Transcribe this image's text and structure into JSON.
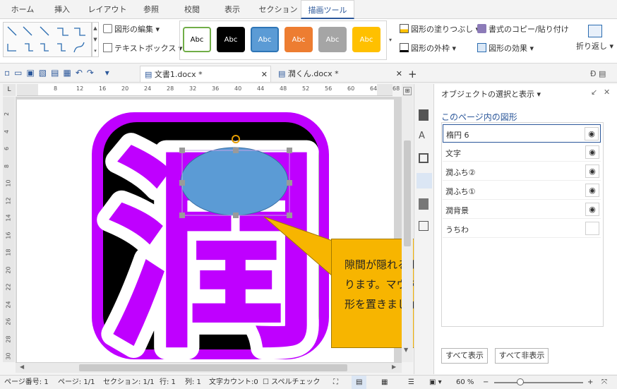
{
  "tabs": [
    "ホーム",
    "挿入",
    "レイアウト",
    "参照",
    "校閲",
    "表示",
    "セクション",
    "描画ツール"
  ],
  "ribbon": {
    "edit_shape": "図形の編集",
    "text_box": "テキストボックス",
    "style_label": "Abc",
    "fill": "図形の塗りつぶし",
    "copy_format": "書式のコピー/貼り付け",
    "outline": "図形の外枠",
    "effect": "図形の効果",
    "wrap": "折り返し"
  },
  "style_colors": [
    "#ffffff",
    "#000000",
    "#5b9bd5",
    "#ed7d31",
    "#a5a5a5",
    "#ffc000"
  ],
  "doc_tabs": [
    "文書1.docx *",
    "潤くん.docx *"
  ],
  "ruler": {
    "h": [
      "8",
      "12",
      "16",
      "20",
      "24",
      "28",
      "32",
      "36",
      "40",
      "44",
      "48",
      "52",
      "56",
      "60",
      "64",
      "68"
    ],
    "v": [
      "2",
      "4",
      "6",
      "8",
      "10",
      "12",
      "14",
      "16",
      "18",
      "20",
      "22",
      "24",
      "26",
      "28",
      "30"
    ]
  },
  "glyph": "潤",
  "callout_text": "隙間が隠れるようなサイズを作ります。マウスで調整して、図形を置きましょう！",
  "panel": {
    "title": "オブジェクトの選択と表示",
    "subtitle": "このページ内の図形",
    "items": [
      {
        "name": "楕円 6",
        "visible": true
      },
      {
        "name": "文字",
        "visible": true
      },
      {
        "name": "潤ふち②",
        "visible": true
      },
      {
        "name": "潤ふち①",
        "visible": true
      },
      {
        "name": "潤背景",
        "visible": true
      },
      {
        "name": "うちわ",
        "visible": false
      }
    ],
    "show_all": "すべて表示",
    "hide_all": "すべて非表示"
  },
  "status": {
    "page_no": "ページ番号: 1",
    "page": "ページ: 1/1",
    "section": "セクション: 1/1",
    "row": "行: 1",
    "col": "列: 1",
    "word_count": "文字カウント:0",
    "spell": "スペルチェック",
    "zoom": "60 %"
  },
  "colors": {
    "accent": "#2b579a",
    "purple": "#bf00ff",
    "ellipse": "#5b9bd5",
    "callout": "#f7b500"
  }
}
